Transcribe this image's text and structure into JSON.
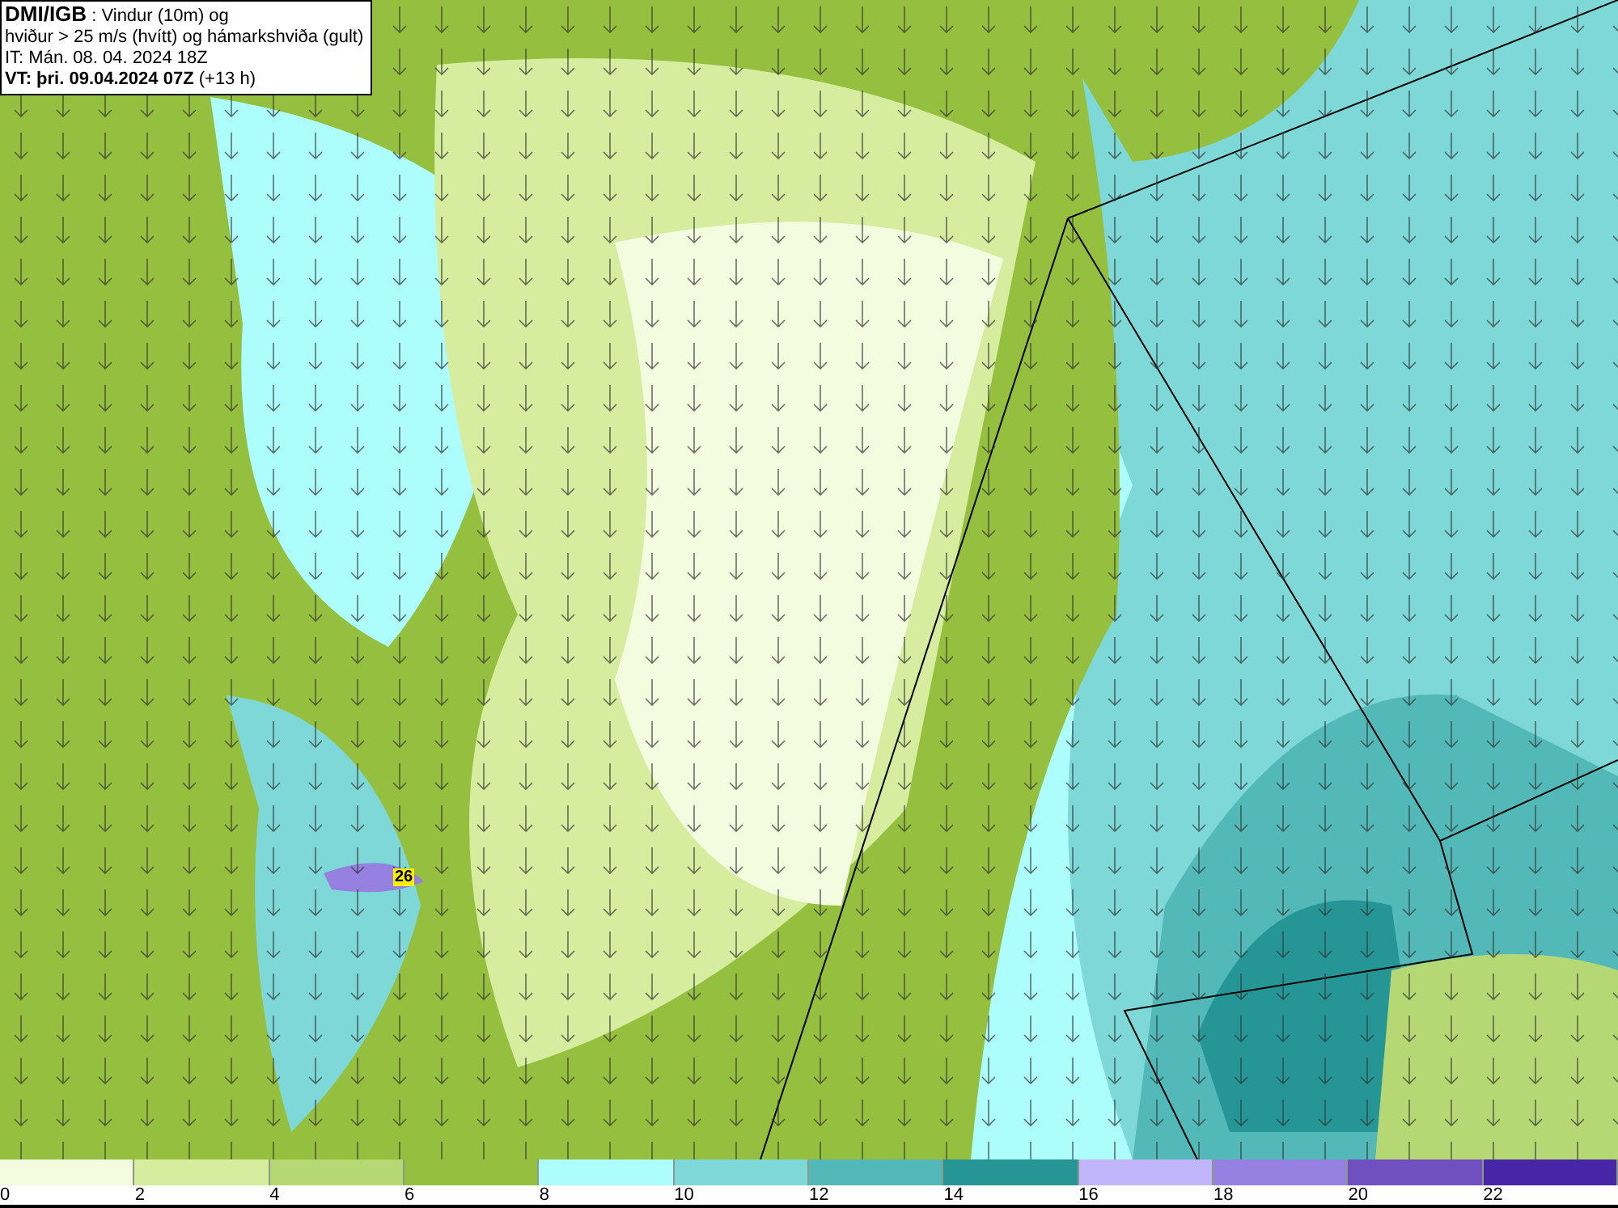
{
  "header": {
    "lines": [
      "**DMI/IGB** : Vindur (10m) og",
      "hviður > 25 m/s (hvítt) og hámarkshviða (gult)",
      "IT: Mán. 08. 04. 2024 18Z",
      "**VT: þri. 09.04.2024 07Z** (+13 h)"
    ]
  },
  "map": {
    "gust_label": "26"
  },
  "legend": [
    {
      "color": "#f4fce0",
      "label": "0"
    },
    {
      "color": "#d6eda0",
      "label": "2"
    },
    {
      "color": "#b5d874",
      "label": "4"
    },
    {
      "color": "#95bf3e",
      "label": "6"
    },
    {
      "color": "#adfdfd",
      "label": "8"
    },
    {
      "color": "#7fd8d8",
      "label": "10"
    },
    {
      "color": "#52b8b8",
      "label": "12"
    },
    {
      "color": "#259595",
      "label": "14"
    },
    {
      "color": "#c0b4fa",
      "label": "16"
    },
    {
      "color": "#9680e0",
      "label": "18"
    },
    {
      "color": "#7050c0",
      "label": "20"
    },
    {
      "color": "#4626a6",
      "label": "22"
    }
  ]
}
